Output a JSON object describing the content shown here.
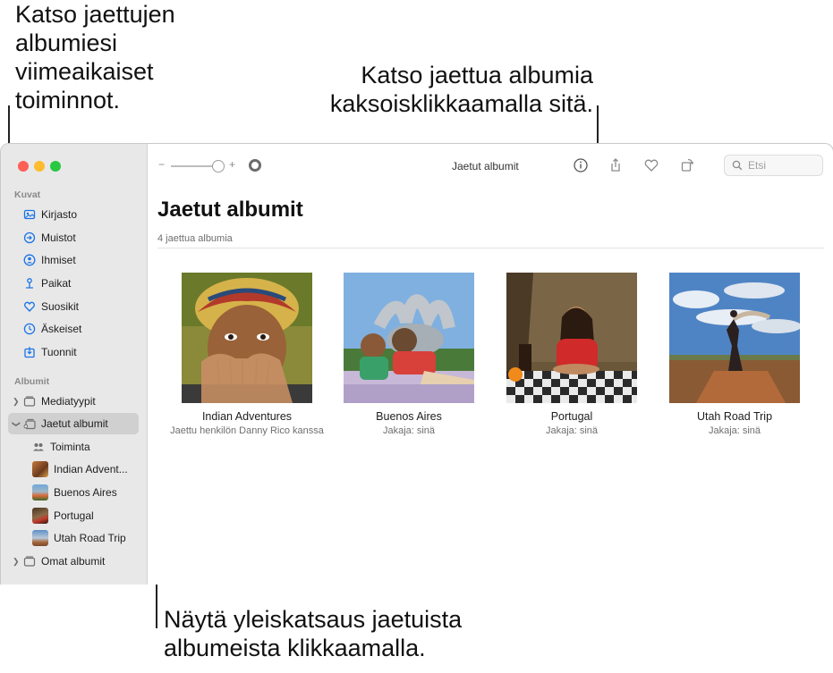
{
  "callouts": {
    "activity": "Katso jaettujen\nalbumiesi\nviimeaikaiset\ntoiminnot.",
    "double_click": "Katso jaettua albumia\nkaksoisklikkaamalla sitä.",
    "overview": "Näytä yleiskatsaus jaetuista\nalbumeista klikkaamalla."
  },
  "sidebar": {
    "section_library": "Kuvat",
    "library_items": [
      {
        "label": "Kirjasto",
        "icon": "photo-library-icon"
      },
      {
        "label": "Muistot",
        "icon": "memories-icon"
      },
      {
        "label": "Ihmiset",
        "icon": "people-icon"
      },
      {
        "label": "Paikat",
        "icon": "places-pin-icon"
      },
      {
        "label": "Suosikit",
        "icon": "heart-icon"
      },
      {
        "label": "Äskeiset",
        "icon": "clock-icon"
      },
      {
        "label": "Tuonnit",
        "icon": "import-icon"
      }
    ],
    "section_albums": "Albumit",
    "media_types": "Mediatyypit",
    "shared_albums": "Jaetut albumit",
    "shared_children": [
      {
        "label": "Toiminta"
      },
      {
        "label": "Indian Advent..."
      },
      {
        "label": "Buenos Aires"
      },
      {
        "label": "Portugal"
      },
      {
        "label": "Utah Road Trip"
      }
    ],
    "my_albums": "Omat albumit"
  },
  "toolbar": {
    "zoom_minus": "−",
    "zoom_plus": "+",
    "title": "Jaetut albumit",
    "search_placeholder": "Etsi"
  },
  "main": {
    "title": "Jaetut albumit",
    "subtitle": "4 jaettua albumia",
    "albums": [
      {
        "name": "Indian Adventures",
        "meta": "Jaettu henkilön Danny Rico kanssa"
      },
      {
        "name": "Buenos Aires",
        "meta": "Jakaja: sinä"
      },
      {
        "name": "Portugal",
        "meta": "Jakaja: sinä"
      },
      {
        "name": "Utah Road Trip",
        "meta": "Jakaja: sinä"
      }
    ]
  },
  "colors": {
    "sidebar_accent": "#1a73e8",
    "sidebar_bg": "#e8e8e8",
    "selected_bg": "#d0d0d0"
  }
}
